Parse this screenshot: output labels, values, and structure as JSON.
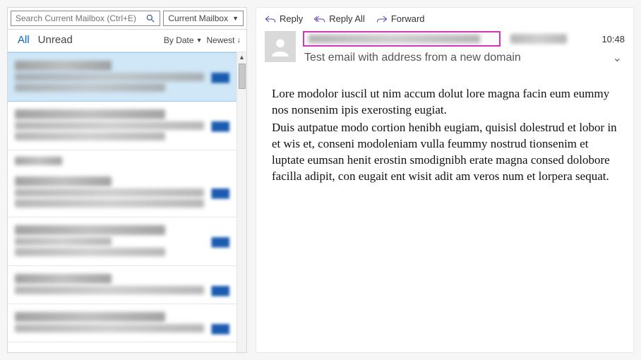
{
  "search": {
    "placeholder": "Search Current Mailbox (Ctrl+E)",
    "scope": "Current Mailbox"
  },
  "tabs": {
    "all": "All",
    "unread": "Unread"
  },
  "sort": {
    "by": "By Date",
    "order": "Newest"
  },
  "actions": {
    "reply": "Reply",
    "reply_all": "Reply All",
    "forward": "Forward"
  },
  "message": {
    "time": "10:48",
    "subject": "Test email with address from a new domain",
    "body_p1": "Lore modolor iuscil ut nim accum dolut lore magna facin eum eummy nos nonsenim ipis exerosting eugiat.",
    "body_p2": "Duis autpatue modo cortion henibh eugiam, quisisl dolestrud et lobor in et wis et, conseni modoleniam vulla feummy nostrud tionsenim et luptate eumsan henit erostin smodignibh erate magna consed dolobore facilla adipit, con eugait ent wisit adit am veros num et lorpera sequat."
  }
}
